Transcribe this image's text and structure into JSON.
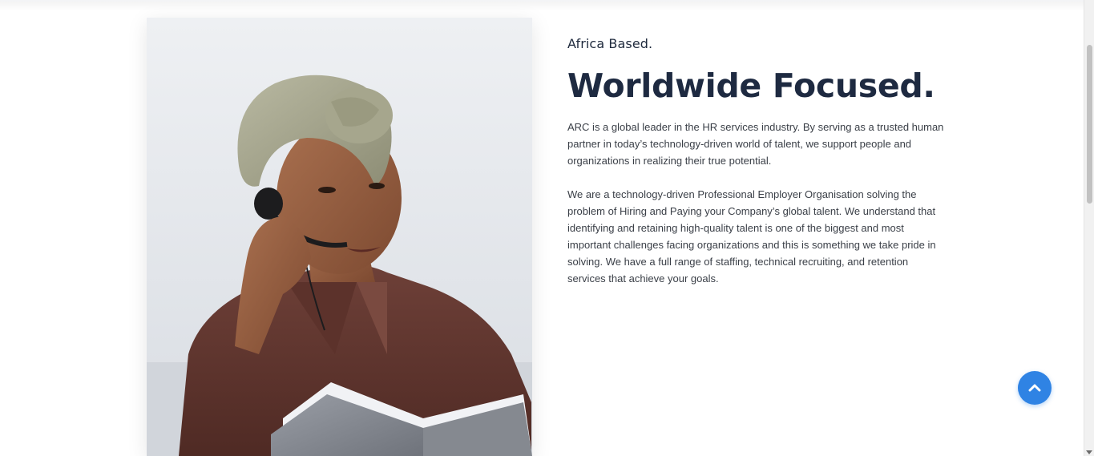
{
  "hero": {
    "image_alt": "Woman wearing a headset and head wrap holding an open notebook",
    "eyebrow": "Africa Based.",
    "headline": "Worldwide Focused.",
    "paragraphs": [
      "ARC is a global leader in the HR services industry. By serving as a trusted human partner in today’s technology-driven world of talent, we support people and organizations in realizing their true potential.",
      "We are a technology-driven Professional Employer Organisation solving the problem of Hiring and Paying your Company’s global talent. We understand that identifying and retaining high-quality talent is one of the biggest and most important challenges facing organizations and this is something we take pride in solving. We have a full range of staffing, technical recruiting, and retention services that achieve your goals."
    ]
  },
  "scroll_top": {
    "icon": "chevron-up-icon",
    "color": "#2f83e4"
  },
  "colors": {
    "heading": "#1e2a41",
    "body_text": "#3a3f47",
    "accent": "#2f83e4",
    "background": "#ffffff"
  }
}
